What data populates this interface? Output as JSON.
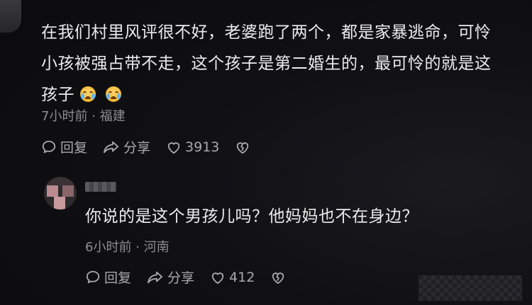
{
  "comment": {
    "lines": [
      "在我们村里风评很不好，老婆跑了两个，都是家暴逃命，可怜",
      "小孩被强占带不走，这个孩子是第二婚生的，最可怜的就是这",
      "孩子"
    ],
    "emojis": [
      "crying-face-icon",
      "crying-face-icon"
    ],
    "meta": "7小时前 · 福建",
    "reply_label": "回复",
    "share_label": "分享",
    "like_count": "3913"
  },
  "reply": {
    "text": "你说的是这个男孩儿吗？他妈妈也不在身边？",
    "meta": "6小时前 · 河南",
    "reply_label": "回复",
    "share_label": "分享",
    "like_count": "412"
  },
  "colors": {
    "background": "#0e0e11",
    "text": "#ececec",
    "meta": "#8d8d92",
    "action": "#a9a9ae"
  }
}
